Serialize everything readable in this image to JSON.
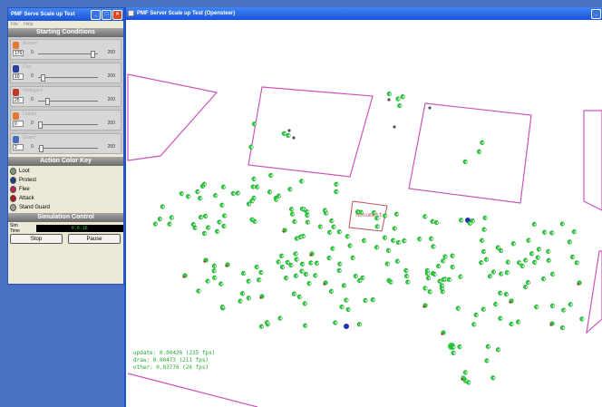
{
  "control_window": {
    "title": "PMF Serve Scale up Test",
    "menu": [
      "File",
      "Help"
    ],
    "starting_conditions_title": "Starting Conditions",
    "conditions": [
      {
        "name": "Activist",
        "value": "176",
        "min": "0",
        "max": "200",
        "level": 0.88,
        "color": "#e07a32"
      },
      {
        "name": "Cop",
        "value": "10",
        "min": "0",
        "max": "200",
        "level": 0.05,
        "color": "#2a3f9a"
      },
      {
        "name": "Hooligans",
        "value": "25",
        "min": "0",
        "max": "200",
        "level": 0.125,
        "color": "#c0392b"
      },
      {
        "name": "Leader",
        "value": "0",
        "min": "0",
        "max": "200",
        "level": 0.0,
        "color": "#e07a32"
      },
      {
        "name": "Guard",
        "value": "2",
        "min": "0",
        "max": "200",
        "level": 0.01,
        "color": "#4a6fb8"
      }
    ],
    "action_key_title": "Action Color Key",
    "action_keys": [
      {
        "label": "Loot",
        "color": "#7a9a7a"
      },
      {
        "label": "Protest",
        "color": "#1e3c8a"
      },
      {
        "label": "Flee",
        "color": "#c51f56"
      },
      {
        "label": "Attack",
        "color": "#b01820"
      },
      {
        "label": "Stand Guard",
        "color": "#9a9a9a"
      }
    ],
    "sim_control_title": "Simulation Control",
    "sim_time_label": "Sim Time",
    "sim_time_value": "0.0:16",
    "stop_label": "Stop",
    "pause_label": "Pause"
  },
  "main_window": {
    "title": "PMF Server Scale up Test (Opensteer)",
    "monument_label": "Monument",
    "stats": [
      "update: 0.00426 (235 fps)",
      "draw: 0.00473 (211 fps)",
      "other: 0.03776 (26 fps)"
    ]
  },
  "colors": {
    "agent_green": "#2ecc40",
    "attack_red": "#c0141e",
    "cop_blue": "#2233aa",
    "boundary_magenta": "#cc55bb",
    "monument_red": "#c0505a",
    "stats_green": "#22aa33"
  }
}
